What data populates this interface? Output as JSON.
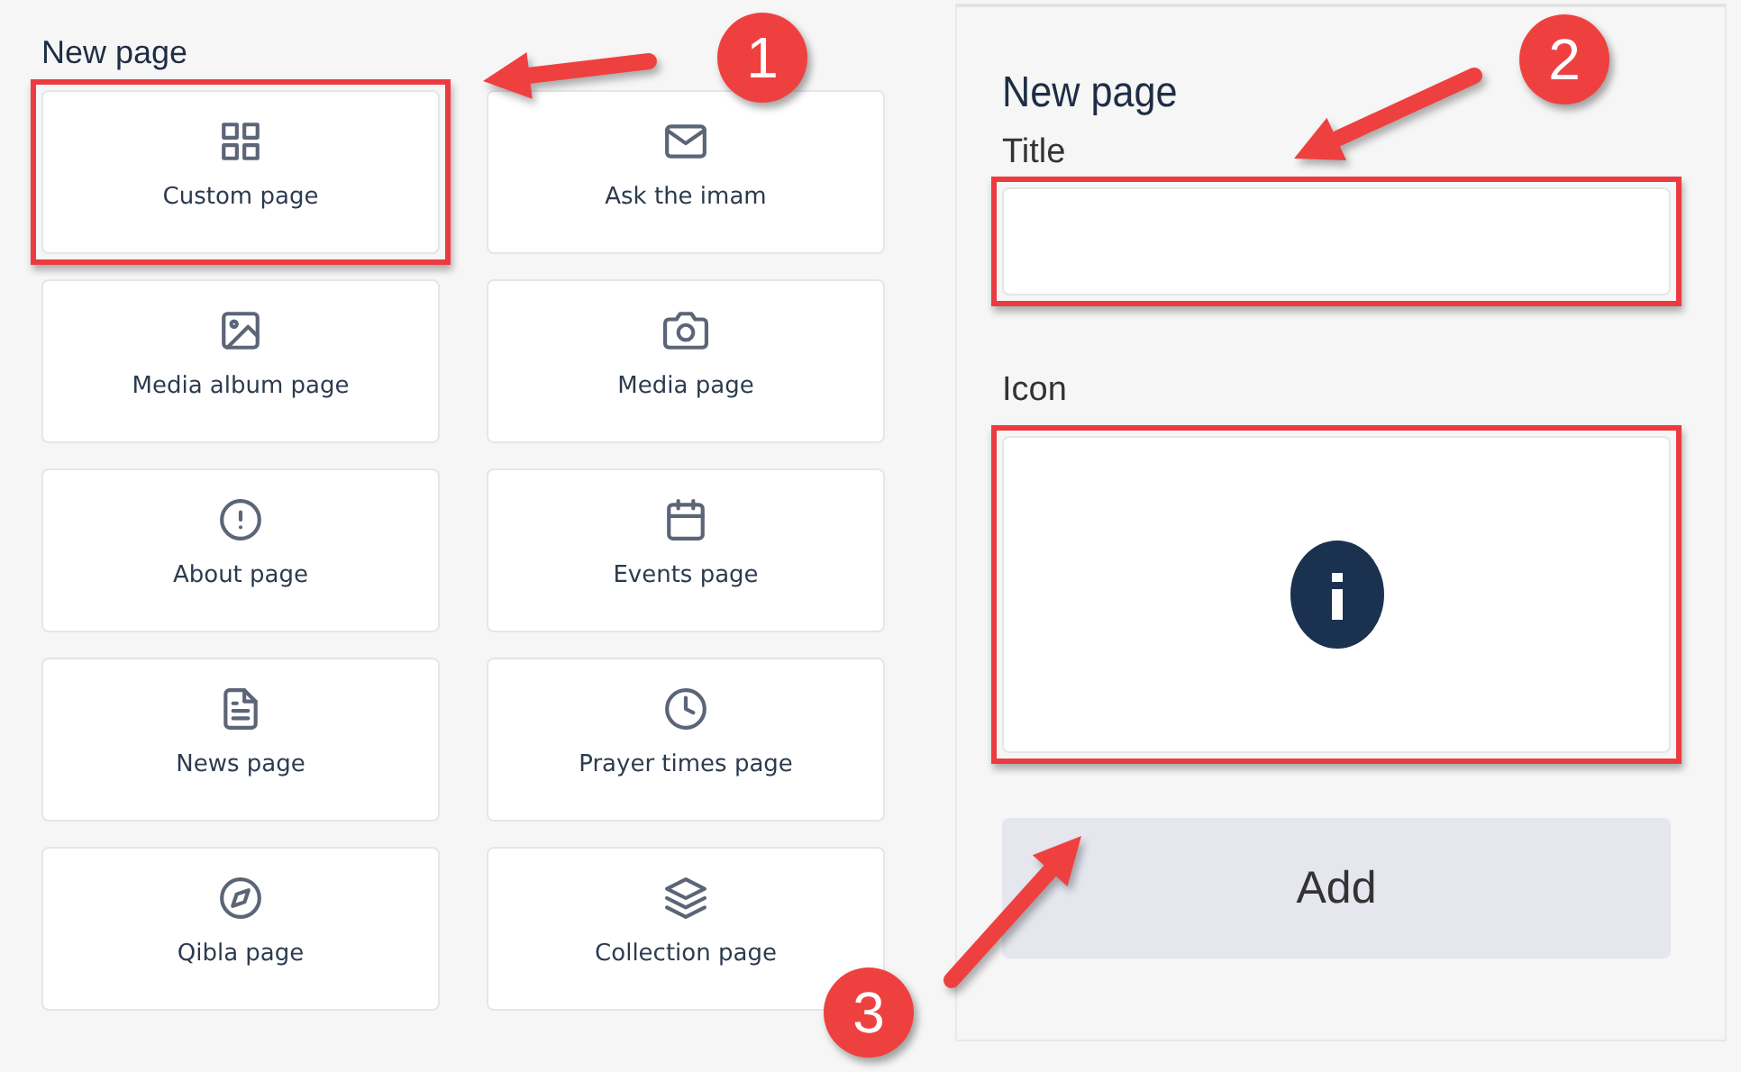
{
  "left_panel": {
    "heading": "New page",
    "page_types": [
      {
        "label": "Custom page",
        "highlighted": true
      },
      {
        "label": "Ask the imam",
        "highlighted": false
      },
      {
        "label": "Media album page",
        "highlighted": false
      },
      {
        "label": "Media page",
        "highlighted": false
      },
      {
        "label": "About page",
        "highlighted": false
      },
      {
        "label": "Events page",
        "highlighted": false
      },
      {
        "label": "News page",
        "highlighted": false
      },
      {
        "label": "Prayer times page",
        "highlighted": false
      },
      {
        "label": "Qibla page",
        "highlighted": false
      },
      {
        "label": "Collection page",
        "highlighted": false
      }
    ]
  },
  "form": {
    "heading": "New page",
    "title_label": "Title",
    "title_field": {
      "highlighted": true
    },
    "icon_label": "Icon",
    "icon_box": {
      "highlighted": true
    },
    "add_button": "Add"
  },
  "callouts": [
    {
      "number": "1"
    },
    {
      "number": "2"
    },
    {
      "number": "3"
    }
  ]
}
